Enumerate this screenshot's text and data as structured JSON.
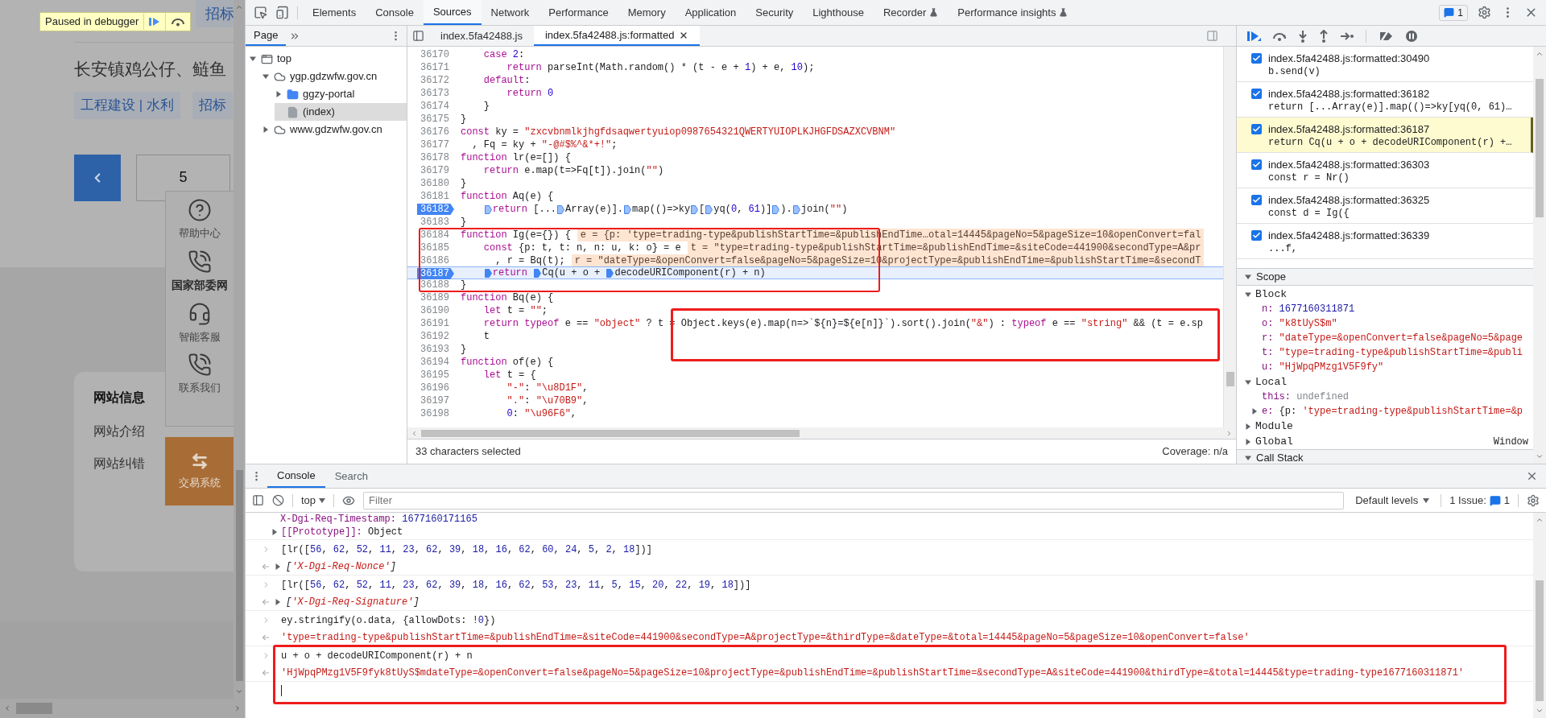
{
  "website": {
    "tooltip": {
      "text": "Paused in debugger"
    },
    "top_tag": "招标",
    "title": "长安镇鸡公仔、鲢鱼",
    "tags": [
      "工程建设 | 水利",
      "招标"
    ],
    "page": "5",
    "float_menu": [
      {
        "kind": "help",
        "label": "帮助中心",
        "bold": false
      },
      {
        "kind": "phone",
        "label": "国家部委网",
        "bold": true
      },
      {
        "kind": "headset",
        "label": "智能客服",
        "bold": false
      },
      {
        "kind": "phone",
        "label": "联系我们",
        "bold": false
      }
    ],
    "trade_button": "交易系统",
    "info_card": {
      "title": "网站信息",
      "links": [
        "网站介绍",
        "网站纠错"
      ]
    }
  },
  "devtools": {
    "tabs": [
      {
        "label": "Elements",
        "selected": false,
        "experimental": false
      },
      {
        "label": "Console",
        "selected": false,
        "experimental": false
      },
      {
        "label": "Sources",
        "selected": true,
        "experimental": false
      },
      {
        "label": "Network",
        "selected": false,
        "experimental": false
      },
      {
        "label": "Performance",
        "selected": false,
        "experimental": false
      },
      {
        "label": "Memory",
        "selected": false,
        "experimental": false
      },
      {
        "label": "Application",
        "selected": false,
        "experimental": false
      },
      {
        "label": "Security",
        "selected": false,
        "experimental": false
      },
      {
        "label": "Lighthouse",
        "selected": false,
        "experimental": false
      },
      {
        "label": "Recorder",
        "selected": false,
        "experimental": true
      },
      {
        "label": "Performance insights",
        "selected": false,
        "experimental": true
      }
    ],
    "issues_count": "1",
    "navigator": {
      "tab": "Page",
      "tree": [
        {
          "label": "top",
          "kind": "frame",
          "expanded": true,
          "selected": false,
          "children": [
            {
              "label": "ygp.gdzwfw.gov.cn",
              "kind": "domain",
              "expanded": true,
              "selected": false,
              "children": [
                {
                  "label": "ggzy-portal",
                  "kind": "folder",
                  "expanded": false,
                  "selected": false
                },
                {
                  "label": "(index)",
                  "kind": "file",
                  "selected": true
                }
              ]
            },
            {
              "label": "www.gdzwfw.gov.cn",
              "kind": "domain",
              "expanded": false,
              "selected": false
            }
          ]
        }
      ]
    },
    "editor": {
      "files": [
        {
          "label": "index.5fa42488.js",
          "selected": false
        },
        {
          "label": "index.5fa42488.js:formatted",
          "selected": true
        }
      ],
      "lines": [
        {
          "number": "36170",
          "parts": [
            "    case 2:"
          ],
          "breakpoint": false,
          "paused": false
        },
        {
          "number": "36171",
          "parts": [
            "        return parseInt(Math.random() * (t - e + 1) + e, 10);"
          ],
          "breakpoint": false,
          "paused": false
        },
        {
          "number": "36172",
          "parts": [
            "    default:"
          ],
          "breakpoint": false,
          "paused": false
        },
        {
          "number": "36173",
          "parts": [
            "        return 0"
          ],
          "breakpoint": false,
          "paused": false
        },
        {
          "number": "36174",
          "parts": [
            "    }"
          ],
          "breakpoint": false,
          "paused": false
        },
        {
          "number": "36175",
          "parts": [
            "}"
          ],
          "breakpoint": false,
          "paused": false
        },
        {
          "number": "36176",
          "parts": [
            "const ky = \"zxcvbnmlkjhgfdsaqwertyuiop0987654321QWERTYUIOPLKJHGFDSAZXCVBNM\""
          ],
          "breakpoint": false,
          "paused": false
        },
        {
          "number": "36177",
          "parts": [
            "  , Fq = ky + \"-@#$%^&*+!\";"
          ],
          "breakpoint": false,
          "paused": false
        },
        {
          "number": "36178",
          "parts": [
            "function lr(e=[]) {"
          ],
          "breakpoint": false,
          "paused": false
        },
        {
          "number": "36179",
          "parts": [
            "    return e.map(t=>Fq[t]).join(\"\")"
          ],
          "breakpoint": false,
          "paused": false
        },
        {
          "number": "36180",
          "parts": [
            "}"
          ],
          "breakpoint": false,
          "paused": false
        },
        {
          "number": "36181",
          "parts": [
            "function Aq(e) {"
          ],
          "breakpoint": false,
          "paused": false
        },
        {
          "number": "36182",
          "parts": [
            "    return [...",
            "Array(e)].",
            "map(()=>ky",
            "[",
            "yq(0, 61)]",
            ").",
            "join(\"\")"
          ],
          "breakpoint": true,
          "paused": false
        },
        {
          "number": "36183",
          "parts": [
            "}"
          ],
          "breakpoint": false,
          "paused": false
        },
        {
          "number": "36184",
          "parts": [
            "function Ig(e={}) {"
          ],
          "inline_value": "e = {p: 'type=trading-type&publishStartTime=&publishEndTime…otal=14445&pageNo=5&pageSize=10&openConvert=fal",
          "breakpoint": false,
          "paused": false
        },
        {
          "number": "36185",
          "parts": [
            "    const {p: t, t: n, n: u, k: o} = e"
          ],
          "inline_value": "t = \"type=trading-type&publishStartTime=&publishEndTime=&siteCode=441900&secondType=A&pr",
          "breakpoint": false,
          "paused": false
        },
        {
          "number": "36186",
          "parts": [
            "      , r = Bq(t);"
          ],
          "inline_value": "r = \"dateType=&openConvert=false&pageNo=5&pageSize=10&projectType=&publishEndTime=&publishStartTime=&secondT",
          "breakpoint": false,
          "paused": false
        },
        {
          "number": "36187",
          "parts": [
            "    return ",
            "Cq(u + o + ",
            "decodeURIComponent(r) + n)"
          ],
          "breakpoint": true,
          "paused": true
        },
        {
          "number": "36188",
          "parts": [
            "}"
          ],
          "breakpoint": false,
          "paused": false
        },
        {
          "number": "36189",
          "parts": [
            "function Bq(e) {"
          ],
          "breakpoint": false,
          "paused": false
        },
        {
          "number": "36190",
          "parts": [
            "    let t = \"\";"
          ],
          "breakpoint": false,
          "paused": false
        },
        {
          "number": "36191",
          "parts": [
            "    return typeof e == \"object\" ? t = Object.keys(e).map(n=>`${n}=${e[n]}`).sort().join(\"&\") : typeof e == \"string\" && (t = e.sp"
          ],
          "breakpoint": false,
          "paused": false
        },
        {
          "number": "36192",
          "parts": [
            "    t"
          ],
          "breakpoint": false,
          "paused": false
        },
        {
          "number": "36193",
          "parts": [
            "}"
          ],
          "breakpoint": false,
          "paused": false
        },
        {
          "number": "36194",
          "parts": [
            "function of(e) {"
          ],
          "breakpoint": false,
          "paused": false
        },
        {
          "number": "36195",
          "parts": [
            "    let t = {"
          ],
          "breakpoint": false,
          "paused": false
        },
        {
          "number": "36196",
          "parts": [
            "        \"-\": \"\\u8D1F\","
          ],
          "breakpoint": false,
          "paused": false
        },
        {
          "number": "36197",
          "parts": [
            "        \".\": \"\\u70B9\","
          ],
          "breakpoint": false,
          "paused": false
        },
        {
          "number": "36198",
          "parts": [
            "        0: \"\\u96F6\","
          ],
          "breakpoint": false,
          "paused": false
        }
      ],
      "status": "33 characters selected",
      "coverage": "Coverage: n/a"
    },
    "debugger": {
      "breakpoints": [
        {
          "location": "index.5fa42488.js:formatted:30490",
          "code": "b.send(v)",
          "checked": true,
          "selected": false
        },
        {
          "location": "index.5fa42488.js:formatted:36182",
          "code": "return [...Array(e)].map(()=>ky[yq(0, 61)…",
          "checked": true,
          "selected": false
        },
        {
          "location": "index.5fa42488.js:formatted:36187",
          "code": "return Cq(u + o + decodeURIComponent(r) +…",
          "checked": true,
          "selected": true
        },
        {
          "location": "index.5fa42488.js:formatted:36303",
          "code": "const r = Nr()",
          "checked": true,
          "selected": false
        },
        {
          "location": "index.5fa42488.js:formatted:36325",
          "code": "const d = Ig({",
          "checked": true,
          "selected": false
        },
        {
          "location": "index.5fa42488.js:formatted:36339",
          "code": "...f,",
          "checked": true,
          "selected": false
        }
      ],
      "scope": {
        "title": "Scope",
        "expanded": true,
        "groups": [
          {
            "name": "Block",
            "expanded": true,
            "vars": [
              {
                "name": "n:",
                "value": "1677160311871",
                "kind": "number"
              },
              {
                "name": "o:",
                "value": "\"k8tUyS$m\"",
                "kind": "string"
              },
              {
                "name": "r:",
                "value": "\"dateType=&openConvert=false&pageNo=5&page",
                "kind": "string"
              },
              {
                "name": "t:",
                "value": "\"type=trading-type&publishStartTime=&publi",
                "kind": "string"
              },
              {
                "name": "u:",
                "value": "\"HjWpqPMzg1V5F9fy\"",
                "kind": "string"
              }
            ]
          },
          {
            "name": "Local",
            "expanded": true,
            "vars": [
              {
                "name": "this:",
                "value": "undefined",
                "kind": "undefined"
              },
              {
                "name": "e:",
                "prefix": "{p: ",
                "value": "'type=trading-type&publishStartTime=&p",
                "kind": "object"
              }
            ]
          },
          {
            "name": "Module",
            "expanded": false
          },
          {
            "name": "Global",
            "expanded": false,
            "value": "Window"
          }
        ]
      },
      "call_stack": {
        "title": "Call Stack",
        "expanded": true
      }
    },
    "console": {
      "tabs": [
        {
          "label": "Console",
          "selected": true
        },
        {
          "label": "Search",
          "selected": false
        }
      ],
      "context": "top",
      "filter_placeholder": "Filter",
      "levels": "Default levels",
      "issues_label": "1 Issue:",
      "issues_count": "1",
      "messages": [
        {
          "kind": "property",
          "key": "X-Dgi-Req-Timestamp:",
          "value": "1677160171165"
        },
        {
          "kind": "prototype",
          "key": "[[Prototype]]:",
          "value": "Object"
        },
        {
          "kind": "input",
          "text": "[lr([56, 62, 52, 11, 23, 62, 39, 18, 16, 62, 60, 24, 5, 2, 18])]"
        },
        {
          "kind": "array",
          "text": "['X-Dgi-Req-Nonce']"
        },
        {
          "kind": "input",
          "text": "[lr([56, 62, 52, 11, 23, 62, 39, 18, 16, 62, 53, 23, 11, 5, 15, 20, 22, 19, 18])]"
        },
        {
          "kind": "array",
          "text": "['X-Dgi-Req-Signature']"
        },
        {
          "kind": "input",
          "text": "ey.stringify(o.data, {allowDots: !0})"
        },
        {
          "kind": "string",
          "text": "'type=trading-type&publishStartTime=&publishEndTime=&siteCode=441900&secondType=A&projectType=&thirdType=&dateType=&total=14445&pageNo=5&pageSize=10&openConvert=false'"
        },
        {
          "kind": "input",
          "text": "u + o + decodeURIComponent(r) + n"
        },
        {
          "kind": "string",
          "text": "'HjWpqPMzg1V5F9fyk8tUyS$mdateType=&openConvert=false&pageNo=5&pageSize=10&projectType=&publishEndTime=&publishStartTime=&secondType=A&siteCode=441900&thirdType=&total=14445&type=trading-type1677160311871'"
        },
        {
          "kind": "prompt"
        }
      ]
    }
  }
}
